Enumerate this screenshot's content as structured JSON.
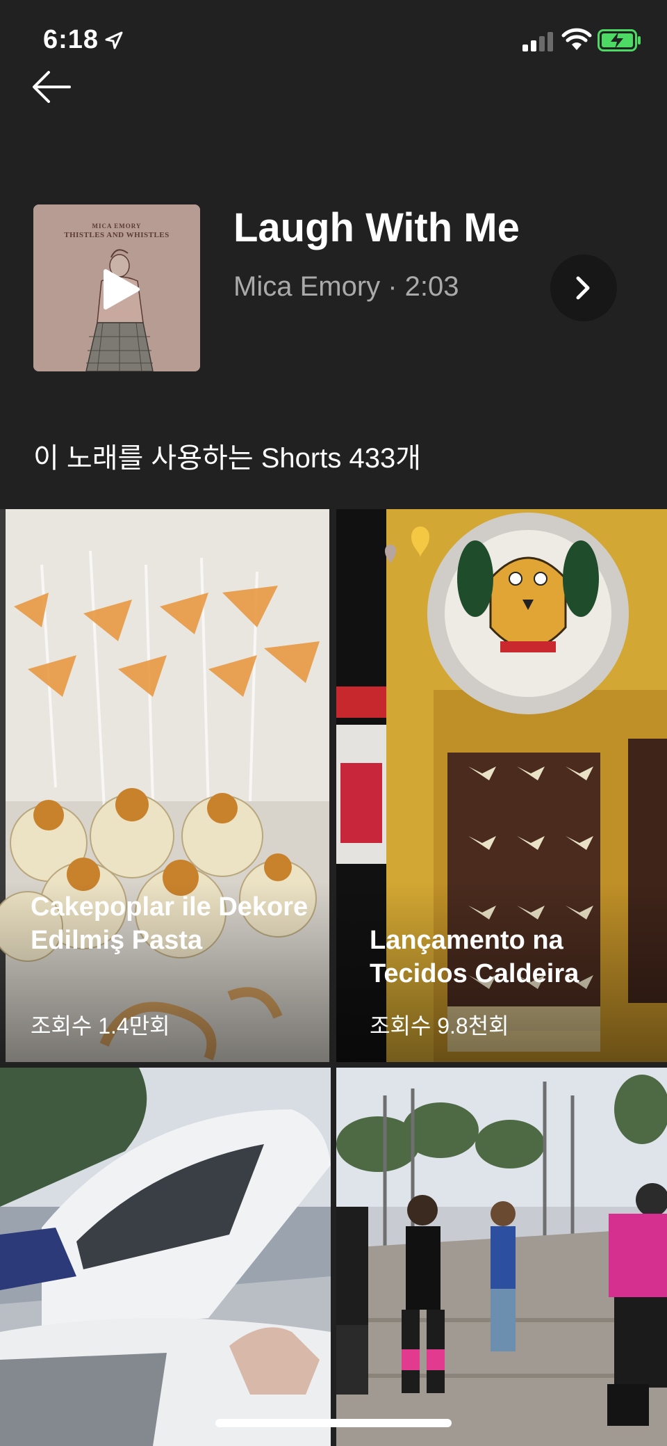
{
  "status_bar": {
    "time": "6:18"
  },
  "song": {
    "title": "Laugh With Me",
    "meta": "Mica Emory · 2:03",
    "album_caption_artist": "MICA EMORY",
    "album_caption_title": "THISTLES AND WHISTLES"
  },
  "shorts": {
    "count_label": "이 노래를 사용하는 Shorts 433개",
    "items": [
      {
        "title": "Cakepoplar ile Dekore Edilmiş Pasta",
        "views": "조회수 1.4만회"
      },
      {
        "title": "Lançamento na Tecidos Caldeira",
        "views": "조회수 9.8천회"
      },
      {
        "title": "",
        "views": ""
      },
      {
        "title": "",
        "views": ""
      }
    ]
  },
  "colors": {
    "background": "#212121",
    "battery": "#4cd964",
    "meta_text": "#aaaaaa"
  }
}
